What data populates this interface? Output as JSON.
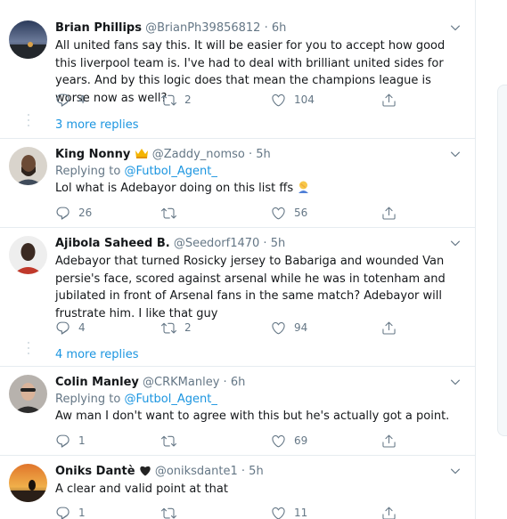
{
  "tweets": [
    {
      "name": "Brian Phillips",
      "handle": "@BrianPh39856812",
      "sep": "·",
      "time": "6h",
      "text": "All united fans say this. It will be easier for you to accept how good this liverpool team is. I've had to deal with brilliant united sides for years. And by this logic does that mean the champions league is worse now as well?",
      "replies": "4",
      "retweets": "2",
      "likes": "104",
      "more_replies": "3 more replies"
    },
    {
      "name": "King Nonny",
      "handle": "@Zaddy_nomso",
      "sep": "·",
      "time": "5h",
      "replying_label": "Replying to",
      "replying_handle": "@Futbol_Agent_",
      "text": "Lol what is Adebayor doing on this list ffs",
      "replies": "26",
      "retweets": "",
      "likes": "56"
    },
    {
      "name": "Ajibola Saheed B.",
      "handle": "@Seedorf1470",
      "sep": "·",
      "time": "5h",
      "text": "Adebayor that turned Rosicky jersey to Babariga and wounded Van persie's face, scored against arsenal while he was in totenham and jubilated in front of Arsenal fans in the same match? Adebayor will frustrate him. I like that guy",
      "replies": "4",
      "retweets": "2",
      "likes": "94",
      "more_replies": "4 more replies"
    },
    {
      "name": "Colin Manley",
      "handle": "@CRKManley",
      "sep": "·",
      "time": "6h",
      "replying_label": "Replying to",
      "replying_handle": "@Futbol_Agent_",
      "text": "Aw man I don't want to agree with this but he's actually got a point.",
      "replies": "1",
      "retweets": "",
      "likes": "69"
    },
    {
      "name": "Oniks Dantè",
      "handle": "@oniksdante1",
      "sep": "·",
      "time": "5h",
      "text": "A clear and valid point at that",
      "replies": "1",
      "retweets": "",
      "likes": "11"
    }
  ],
  "colors": {
    "accent": "#1b95e0",
    "muted": "#657786",
    "border": "#e6ecf0",
    "text": "#14171a"
  },
  "icons": {
    "reply": "reply-icon",
    "retweet": "retweet-icon",
    "like": "heart-icon",
    "share": "share-icon",
    "caret": "chevron-down-icon",
    "crown": "crown-emoji",
    "facepalm": "facepalm-emoji",
    "heart_black": "black-heart-emoji"
  }
}
